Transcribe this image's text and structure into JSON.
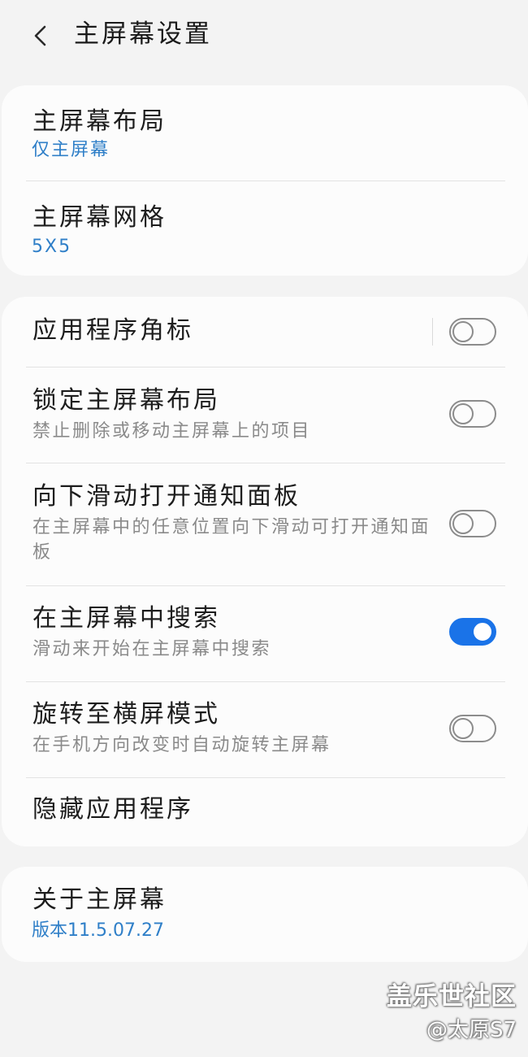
{
  "header": {
    "title": "主屏幕设置",
    "back_icon": "chevron-left-icon"
  },
  "card1": {
    "layout": {
      "title": "主屏幕布局",
      "value": "仅主屏幕"
    },
    "grid": {
      "title": "主屏幕网格",
      "value": "5X5"
    }
  },
  "card2": {
    "app_badges": {
      "title": "应用程序角标",
      "toggle": false
    },
    "lock_layout": {
      "title": "锁定主屏幕布局",
      "subtitle": "禁止删除或移动主屏幕上的项目",
      "toggle": false
    },
    "swipe_notifications": {
      "title": "向下滑动打开通知面板",
      "subtitle": "在主屏幕中的任意位置向下滑动可打开通知面板",
      "toggle": false
    },
    "search": {
      "title": "在主屏幕中搜索",
      "subtitle": "滑动来开始在主屏幕中搜索",
      "toggle": true
    },
    "rotate": {
      "title": "旋转至横屏模式",
      "subtitle": "在手机方向改变时自动旋转主屏幕",
      "toggle": false
    },
    "hide_apps": {
      "title": "隐藏应用程序"
    }
  },
  "card3": {
    "about": {
      "title": "关于主屏幕",
      "value": "版本11.5.07.27"
    }
  },
  "watermark": {
    "line1": "盖乐世社区",
    "line2": "@太原S7"
  },
  "colors": {
    "accent": "#2f7fc8",
    "toggle_on": "#1a73e8",
    "background": "#f3f3f3",
    "card": "#fcfcfc"
  }
}
